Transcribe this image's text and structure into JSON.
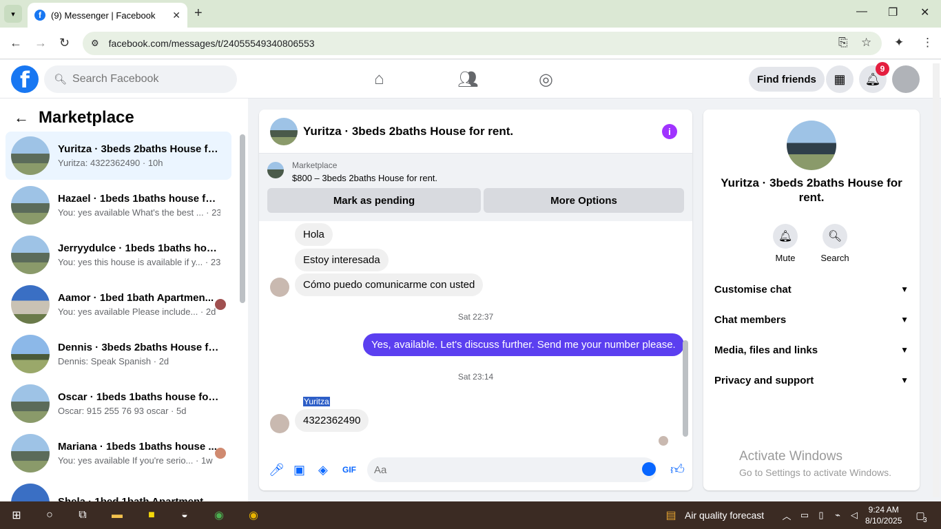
{
  "browser": {
    "tab_title": "(9) Messenger | Facebook",
    "url": "facebook.com/messages/t/24055549340806553"
  },
  "fb": {
    "search_placeholder": "Search Facebook",
    "find_friends": "Find friends",
    "notification_count": "9"
  },
  "sidebar": {
    "title": "Marketplace",
    "conversations": [
      {
        "name": "Yuritza · 3beds 2baths House for...",
        "preview": "Yuritza: 4322362490 · 10h"
      },
      {
        "name": "Hazael · 1beds 1baths house for ...",
        "preview": "You: yes available What's the best ... · 23h"
      },
      {
        "name": "Jerryydulce · 1beds 1baths house...",
        "preview": "You: yes this house is available if y... · 23h"
      },
      {
        "name": "Aamor · 1bed 1bath Apartmen...",
        "preview": "You: yes available Please include... · 2d"
      },
      {
        "name": "Dennis · 3beds 2baths House for...",
        "preview": "Dennis: Speak Spanish · 2d"
      },
      {
        "name": "Oscar · 1beds 1baths house for r...",
        "preview": "Oscar: 915 255 76 93 oscar · 5d"
      },
      {
        "name": "Mariana · 1beds 1baths house ...",
        "preview": "You: yes available If you're serio... · 1w"
      },
      {
        "name": "Shela · 1bed 1bath Apartment ...",
        "preview": ""
      }
    ]
  },
  "chat": {
    "title": "Yuritza · 3beds 2baths House for rent.",
    "marketplace_label": "Marketplace",
    "listing": "$800 – 3beds 2baths House for rent.",
    "mark_pending": "Mark as pending",
    "more_options": "More Options",
    "messages": {
      "m1": "Hola",
      "m2": "Estoy interesada",
      "m3": "Cómo puedo comunicarme con usted",
      "ts1": "Sat 22:37",
      "m4": "Yes, available. Let's discuss further. Send me your number please.",
      "ts2": "Sat 23:14",
      "sender": "Yuritza",
      "m5": "4322362490"
    },
    "composer_placeholder": "Aa"
  },
  "right_panel": {
    "name": "Yuritza · 3beds 2baths House for rent.",
    "mute": "Mute",
    "search": "Search",
    "rows": [
      "Customise chat",
      "Chat members",
      "Media, files and links",
      "Privacy and support"
    ]
  },
  "watermark": {
    "line1": "Activate Windows",
    "line2": "Go to Settings to activate Windows."
  },
  "taskbar": {
    "weather": "Air quality forecast",
    "time": "9:24 AM",
    "date": "8/10/2025",
    "notif_count": "3"
  }
}
